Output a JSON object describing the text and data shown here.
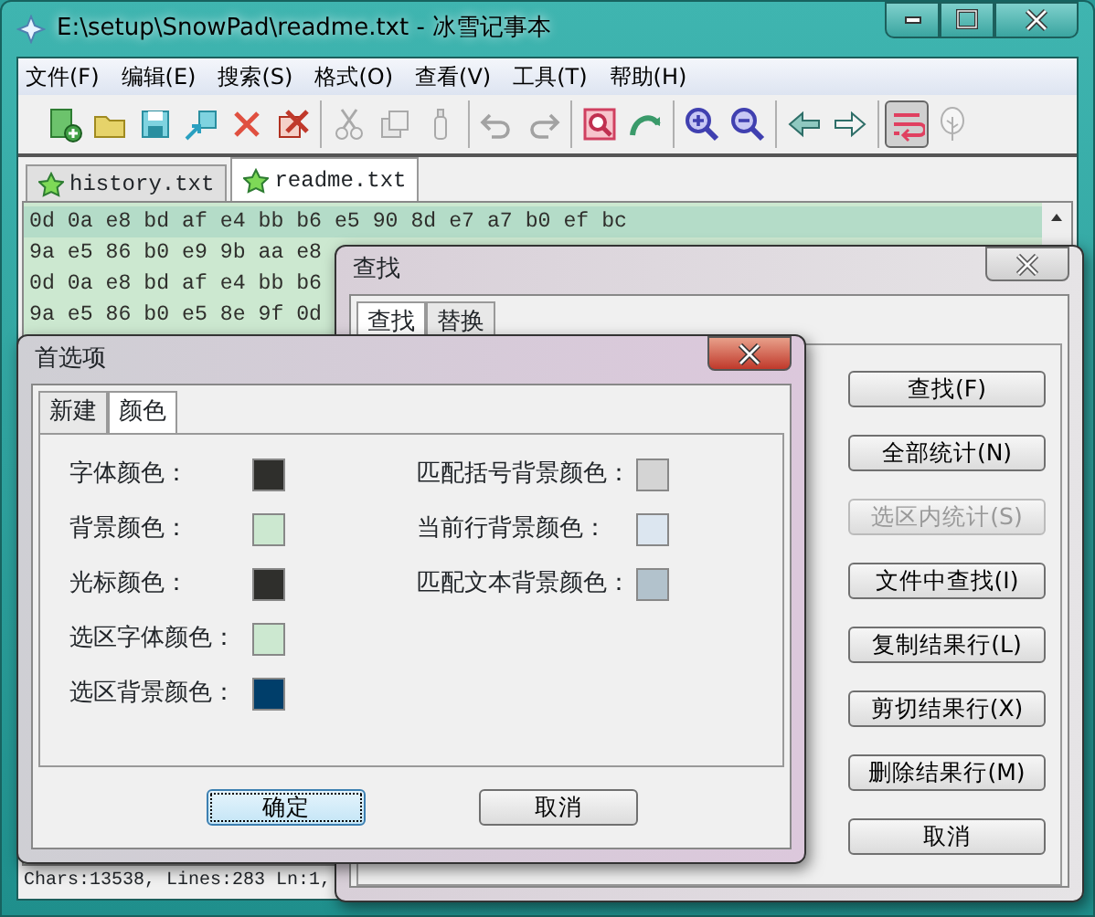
{
  "window": {
    "title": "E:\\setup\\SnowPad\\readme.txt - 冰雪记事本"
  },
  "menu": [
    "文件(F)",
    "编辑(E)",
    "搜索(S)",
    "格式(O)",
    "查看(V)",
    "工具(T)",
    "帮助(H)"
  ],
  "toolbar": [
    [
      {
        "kind": "new",
        "disabled": false,
        "selected": false
      },
      {
        "kind": "open",
        "disabled": false,
        "selected": false
      },
      {
        "kind": "save",
        "disabled": false,
        "selected": false
      },
      {
        "kind": "saveall",
        "disabled": false,
        "selected": false
      },
      {
        "kind": "close",
        "disabled": false,
        "selected": false
      },
      {
        "kind": "closeall",
        "disabled": false,
        "selected": false
      }
    ],
    [
      {
        "kind": "cut",
        "disabled": true,
        "selected": false
      },
      {
        "kind": "copy",
        "disabled": true,
        "selected": false
      },
      {
        "kind": "paste",
        "disabled": true,
        "selected": false
      }
    ],
    [
      {
        "kind": "undo",
        "disabled": true,
        "selected": false
      },
      {
        "kind": "redo",
        "disabled": true,
        "selected": false
      }
    ],
    [
      {
        "kind": "find",
        "disabled": false,
        "selected": false
      },
      {
        "kind": "replace",
        "disabled": false,
        "selected": false
      }
    ],
    [
      {
        "kind": "zoomin",
        "disabled": false,
        "selected": false
      },
      {
        "kind": "zoomout",
        "disabled": false,
        "selected": false
      }
    ],
    [
      {
        "kind": "back",
        "disabled": false,
        "selected": false
      },
      {
        "kind": "forward",
        "disabled": false,
        "selected": false
      }
    ],
    [
      {
        "kind": "wrap",
        "disabled": false,
        "selected": true
      },
      {
        "kind": "tree",
        "disabled": true,
        "selected": false
      }
    ]
  ],
  "tabs": [
    {
      "label": "history.txt",
      "selected": false
    },
    {
      "label": "readme.txt",
      "selected": true
    }
  ],
  "editor": {
    "lines": [
      {
        "text": "0d 0a e8 bd af e4 bb b6 e5 90 8d e7 a7 b0 ef bc",
        "current": true
      },
      {
        "text": "9a e5 86 b0 e9 9b aa e8",
        "current": false
      },
      {
        "text": "0d 0a e8 bd af e4 bb b6",
        "current": false
      },
      {
        "text": "9a e5 86 b0 e5 8e 9f 0d",
        "current": false
      }
    ]
  },
  "status_bar": "Chars:13538, Lines:283 Ln:1,",
  "find_dialog": {
    "title": "查找",
    "tabs": [
      {
        "label": "查找",
        "selected": true
      },
      {
        "label": "替换",
        "selected": false
      }
    ],
    "buttons": [
      {
        "label": "查找(F)",
        "disabled": false
      },
      {
        "label": "全部统计(N)",
        "disabled": false
      },
      {
        "label": "选区内统计(S)",
        "disabled": true
      },
      {
        "label": "文件中查找(I)",
        "disabled": false
      },
      {
        "label": "复制结果行(L)",
        "disabled": false
      },
      {
        "label": "剪切结果行(X)",
        "disabled": false
      },
      {
        "label": "删除结果行(M)",
        "disabled": false
      },
      {
        "label": "取消",
        "disabled": false
      }
    ]
  },
  "preferences_dialog": {
    "title": "首选项",
    "tabs": [
      {
        "label": "新建",
        "selected": false
      },
      {
        "label": "颜色",
        "selected": true
      }
    ],
    "left_colors": [
      {
        "label": "字体颜色：",
        "color": "#2f2f2c"
      },
      {
        "label": "背景颜色：",
        "color": "#cce8d0"
      },
      {
        "label": "光标颜色：",
        "color": "#2f2f2c"
      },
      {
        "label": "选区字体颜色：",
        "color": "#cce8d0"
      },
      {
        "label": "选区背景颜色：",
        "color": "#003e6a"
      }
    ],
    "right_colors": [
      {
        "label": "匹配括号背景颜色：",
        "color": "#d4d4d4"
      },
      {
        "label": "当前行背景颜色：",
        "color": "#dce6f0"
      },
      {
        "label": "匹配文本背景颜色：",
        "color": "#b2c2cc"
      }
    ],
    "buttons": [
      {
        "label": "确定",
        "default": true
      },
      {
        "label": "取消",
        "default": false
      }
    ]
  }
}
